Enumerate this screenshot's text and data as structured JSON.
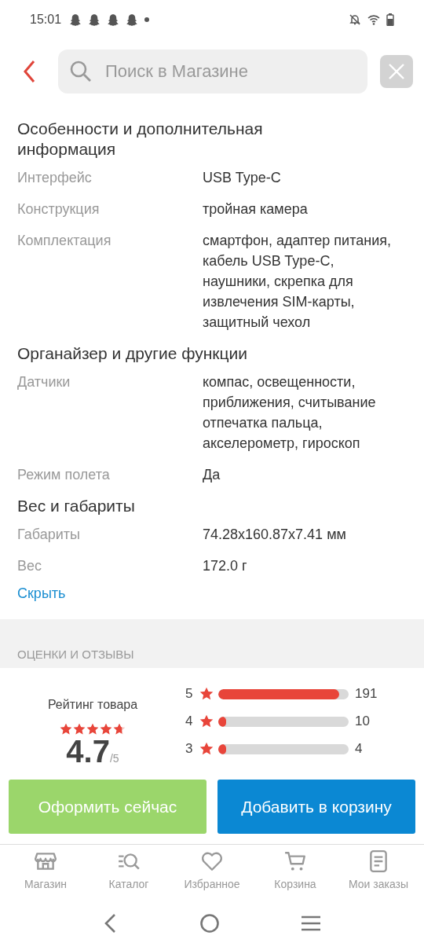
{
  "status_bar": {
    "time": "15:01"
  },
  "header": {
    "search": {
      "placeholder": "Поиск в Магазине"
    }
  },
  "spec_groups": [
    {
      "title": "Особенности и дополнительная информация",
      "rows": [
        {
          "label": "Интерфейс",
          "value": "USB Type-C"
        },
        {
          "label": "Конструкция",
          "value": "тройная камера"
        },
        {
          "label": "Комплектация",
          "value": "смартфон, адаптер питания, кабель USB Type-C, наушники, скрепка для извлечения SIM-карты, защитный чехол"
        }
      ]
    },
    {
      "title": "Органайзер и другие функции",
      "rows": [
        {
          "label": "Датчики",
          "value": "компас, освещенности, приближения, считывание отпечатка пальца, акселерометр, гироскоп"
        },
        {
          "label": "Режим полета",
          "value": "Да"
        }
      ]
    },
    {
      "title": "Вес и габариты",
      "rows": [
        {
          "label": "Габариты",
          "value": "74.28x160.87x7.41 мм"
        },
        {
          "label": "Вес",
          "value": "172.0 г"
        }
      ]
    }
  ],
  "hide_link": "Скрыть",
  "reviews": {
    "section_title": "ОЦЕНКИ И ОТЗЫВЫ",
    "rating_label": "Рейтинг товара",
    "stars": 4.7,
    "rating_value": "4.7",
    "rating_max": "/5",
    "bars": [
      {
        "star": "5",
        "level": 0.93,
        "count": "191"
      },
      {
        "star": "4",
        "level": 0.05,
        "count": "10"
      },
      {
        "star": "3",
        "level": 0.02,
        "count": "4"
      }
    ]
  },
  "actions": [
    {
      "kind": "buy",
      "label": "Оформить сейчас"
    },
    {
      "kind": "cart",
      "label": "Добавить в корзину"
    }
  ],
  "bottom_nav": [
    {
      "label": "Магазин"
    },
    {
      "label": "Каталог"
    },
    {
      "label": "Избранное"
    },
    {
      "label": "Корзина"
    },
    {
      "label": "Мои заказы"
    }
  ]
}
